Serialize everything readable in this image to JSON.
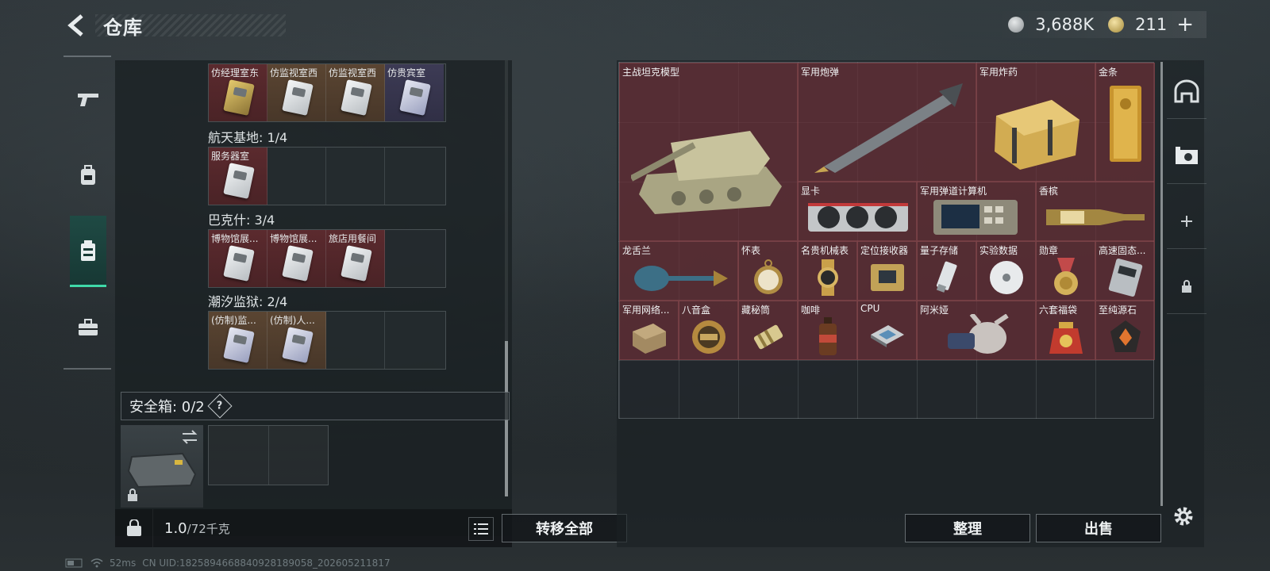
{
  "header": {
    "title": "仓库"
  },
  "currency": {
    "silver_value": "3,688K",
    "gold_value": "211"
  },
  "left": {
    "rows": [
      {
        "labels": [
          "仿经理室东",
          "仿监视室西",
          "仿监视室西",
          "仿贵宾室"
        ]
      },
      {
        "section": "航天基地: 1/4",
        "labels": [
          "服务器室",
          "",
          "",
          ""
        ]
      },
      {
        "section": "巴克什: 3/4",
        "labels": [
          "博物馆展...",
          "博物馆展...",
          "旅店用餐间",
          ""
        ]
      },
      {
        "section": "潮汐监狱: 2/4",
        "labels": [
          "(仿制)监...",
          "(仿制)人...",
          "",
          ""
        ]
      }
    ],
    "safe_box_label": "安全箱: 0/2",
    "help": "?",
    "weight_current": "1.0",
    "weight_max": "/72千克",
    "transfer_all": "转移全部"
  },
  "right": {
    "items": [
      "主战坦克模型",
      "军用炮弹",
      "军用炸药",
      "金条",
      "显卡",
      "军用弹道计算机",
      "香槟",
      "龙舌兰",
      "怀表",
      "名贵机械表",
      "定位接收器",
      "量子存储",
      "实验数据",
      "勋章",
      "高速固态...",
      "军用网络...",
      "八音盒",
      "藏秘筒",
      "咖啡",
      "CPU",
      "阿米娅",
      "六套福袋",
      "至纯源石"
    ],
    "sort_button": "整理",
    "sell_button": "出售"
  },
  "status": {
    "ping": "52ms",
    "uid": "CN UID:1825894668840928189058_202605211817"
  },
  "colors": {
    "accent": "#3fd9a8",
    "item_bg": "#70303a"
  }
}
